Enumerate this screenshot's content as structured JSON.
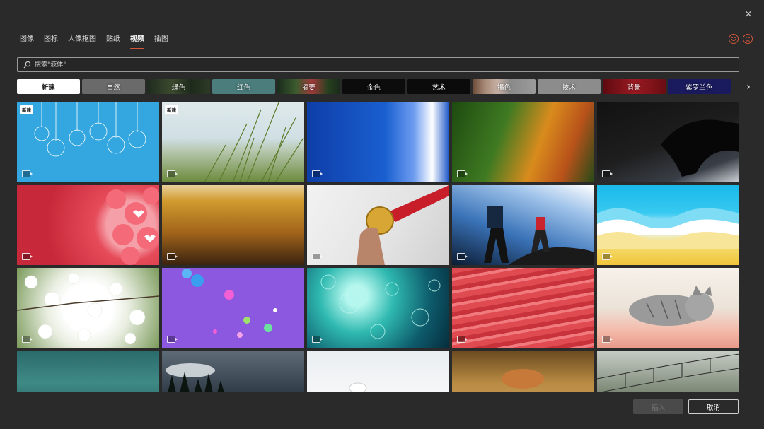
{
  "dialog": {
    "close_label": "×"
  },
  "tabs": [
    {
      "label": "图像",
      "active": false
    },
    {
      "label": "图标",
      "active": false
    },
    {
      "label": "人像抠图",
      "active": false
    },
    {
      "label": "贴纸",
      "active": false
    },
    {
      "label": "视频",
      "active": true
    },
    {
      "label": "插图",
      "active": false
    }
  ],
  "feedback": {
    "happy_icon": "smile-icon",
    "sad_icon": "frown-icon",
    "accent": "#d2573b"
  },
  "search": {
    "placeholder": "搜索\"液体\"",
    "value": ""
  },
  "chips": [
    {
      "label": "新建"
    },
    {
      "label": "自然"
    },
    {
      "label": "绿色"
    },
    {
      "label": "红色"
    },
    {
      "label": "摘要"
    },
    {
      "label": "金色"
    },
    {
      "label": "艺术"
    },
    {
      "label": "褐色"
    },
    {
      "label": "技术"
    },
    {
      "label": "背景"
    },
    {
      "label": "紫罗兰色"
    }
  ],
  "chips_next": "›",
  "thumbs": [
    {
      "subject": "snowflake ornaments",
      "new_tag": "新建"
    },
    {
      "subject": "beach grass",
      "new_tag": "新建"
    },
    {
      "subject": "blue water"
    },
    {
      "subject": "autumn leaves waterfall"
    },
    {
      "subject": "hand on keyboard"
    },
    {
      "subject": "red heart balloons"
    },
    {
      "subject": "wheat field"
    },
    {
      "subject": "gold medal"
    },
    {
      "subject": "mountain climbers"
    },
    {
      "subject": "paper waves"
    },
    {
      "subject": "white blossoms"
    },
    {
      "subject": "floating bubbles"
    },
    {
      "subject": "teal bokeh"
    },
    {
      "subject": "red abstract waves"
    },
    {
      "subject": "sleeping kitten"
    },
    {
      "subject": "sea"
    },
    {
      "subject": "foggy forest"
    },
    {
      "subject": "snow field"
    },
    {
      "subject": "hay bale"
    },
    {
      "subject": "rope bridge"
    }
  ],
  "footer": {
    "insert_label": "插入",
    "cancel_label": "取消"
  }
}
